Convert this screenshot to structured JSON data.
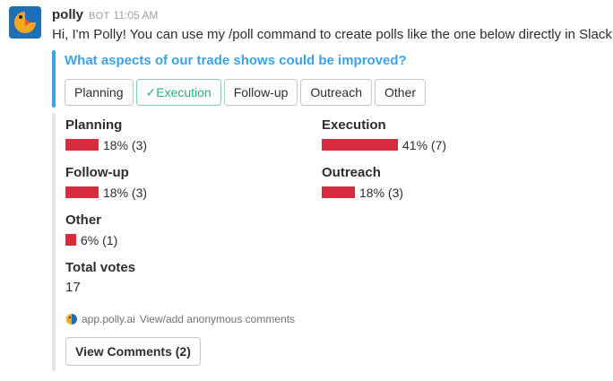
{
  "message": {
    "sender": "polly",
    "bot_tag": "BOT",
    "timestamp": "11:05 AM",
    "text": "Hi, I'm Polly! You can use my /poll command to create polls like the one below directly in Slack."
  },
  "poll": {
    "question": "What aspects of our trade shows could be improved?",
    "buttons": [
      {
        "label": "Planning",
        "selected": false
      },
      {
        "label": "✓Execution",
        "selected": true
      },
      {
        "label": "Follow-up",
        "selected": false
      },
      {
        "label": "Outreach",
        "selected": false
      },
      {
        "label": "Other",
        "selected": false
      }
    ],
    "results": [
      {
        "name": "Planning",
        "result": "18% (3)",
        "fraction": 0.18
      },
      {
        "name": "Execution",
        "result": "41% (7)",
        "fraction": 0.41
      },
      {
        "name": "Follow-up",
        "result": "18% (3)",
        "fraction": 0.18
      },
      {
        "name": "Outreach",
        "result": "18% (3)",
        "fraction": 0.18
      },
      {
        "name": "Other",
        "result": "6% (1)",
        "fraction": 0.06
      }
    ],
    "total_label": "Total votes",
    "total_value": "17",
    "bar_color": "#d72b3f"
  },
  "footer": {
    "site": "app.polly.ai",
    "link_text": "View/add anonymous comments",
    "view_comments_label": "View Comments (2)"
  },
  "colors": {
    "accent": "#3aa3e3",
    "selected": "#2bac76",
    "avatar_bg": "#1e6fb6",
    "avatar_logo": "#f5a623"
  },
  "icons": {
    "avatar": "polly-parrot-logo",
    "footer": "polly-parrot-icon"
  }
}
